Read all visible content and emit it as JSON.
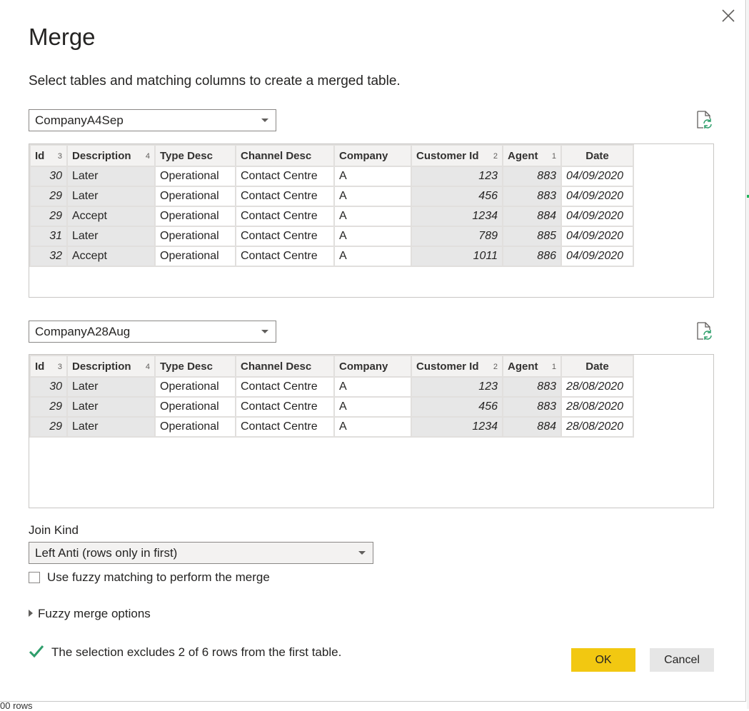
{
  "dialog": {
    "title": "Merge",
    "subtitle": "Select tables and matching columns to create a merged table."
  },
  "first_table": {
    "selected": "CompanyA4Sep",
    "columns": [
      {
        "label": "Id",
        "order": "3"
      },
      {
        "label": "Description",
        "order": "4"
      },
      {
        "label": "Type Desc",
        "order": ""
      },
      {
        "label": "Channel Desc",
        "order": ""
      },
      {
        "label": "Company",
        "order": ""
      },
      {
        "label": "Customer Id",
        "order": "2"
      },
      {
        "label": "Agent",
        "order": "1"
      },
      {
        "label": "Date",
        "order": ""
      }
    ],
    "rows": [
      [
        "30",
        "Later",
        "Operational",
        "Contact Centre",
        "A",
        "123",
        "883",
        "04/09/2020"
      ],
      [
        "29",
        "Later",
        "Operational",
        "Contact Centre",
        "A",
        "456",
        "883",
        "04/09/2020"
      ],
      [
        "29",
        "Accept",
        "Operational",
        "Contact Centre",
        "A",
        "1234",
        "884",
        "04/09/2020"
      ],
      [
        "31",
        "Later",
        "Operational",
        "Contact Centre",
        "A",
        "789",
        "885",
        "04/09/2020"
      ],
      [
        "32",
        "Accept",
        "Operational",
        "Contact Centre",
        "A",
        "1011",
        "886",
        "04/09/2020"
      ]
    ]
  },
  "second_table": {
    "selected": "CompanyA28Aug",
    "columns": [
      {
        "label": "Id",
        "order": "3"
      },
      {
        "label": "Description",
        "order": "4"
      },
      {
        "label": "Type Desc",
        "order": ""
      },
      {
        "label": "Channel Desc",
        "order": ""
      },
      {
        "label": "Company",
        "order": ""
      },
      {
        "label": "Customer Id",
        "order": "2"
      },
      {
        "label": "Agent",
        "order": "1"
      },
      {
        "label": "Date",
        "order": ""
      }
    ],
    "rows": [
      [
        "30",
        "Later",
        "Operational",
        "Contact Centre",
        "A",
        "123",
        "883",
        "28/08/2020"
      ],
      [
        "29",
        "Later",
        "Operational",
        "Contact Centre",
        "A",
        "456",
        "883",
        "28/08/2020"
      ],
      [
        "29",
        "Later",
        "Operational",
        "Contact Centre",
        "A",
        "1234",
        "884",
        "28/08/2020"
      ]
    ]
  },
  "join": {
    "label": "Join Kind",
    "selected": "Left Anti (rows only in first)"
  },
  "fuzzy": {
    "checkbox_label": "Use fuzzy matching to perform the merge",
    "checked": false,
    "options_label": "Fuzzy merge options"
  },
  "status": {
    "message": "The selection excludes 2 of 6 rows from the first table."
  },
  "buttons": {
    "ok": "OK",
    "cancel": "Cancel"
  },
  "background": {
    "footer_text": "00 rows"
  },
  "icons": {
    "close": "close-icon",
    "refresh": "refresh-file-icon",
    "check": "checkmark-icon",
    "dropdown": "chevron-down-icon",
    "expand": "triangle-right-icon"
  },
  "colors": {
    "ok_button": "#f2c811",
    "check": "#2e9e6b",
    "selected_cell": "#e7e7e7"
  }
}
